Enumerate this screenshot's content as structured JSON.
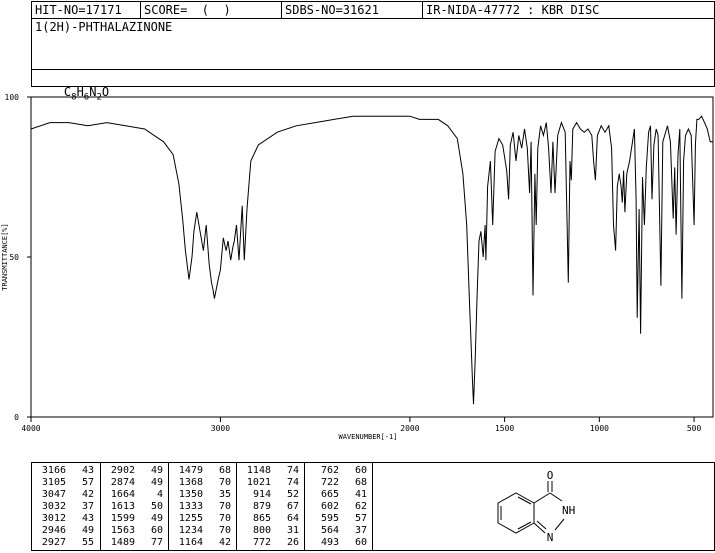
{
  "header": {
    "hit_no": "HIT-NO=17171",
    "score": "SCORE=  (  )",
    "sdbs_no": "SDBS-NO=31621",
    "ir_nida": "IR-NIDA-47772 : KBR DISC"
  },
  "compound": {
    "name": "1(2H)-PHTHALAZINONE",
    "formula_c": "C",
    "formula_c_n": "8",
    "formula_h": "H",
    "formula_h_n": "6",
    "formula_n": "N",
    "formula_n_n": "2",
    "formula_o": "O"
  },
  "chart_data": {
    "type": "line",
    "xlabel": "WAVENUMBER[-1]",
    "ylabel": "TRANSMITTANCE[%]",
    "xlim": [
      4000,
      400
    ],
    "ylim": [
      0,
      100
    ],
    "x_ticks": [
      4000,
      3000,
      2000,
      1500,
      1000,
      500
    ],
    "x_tick_labels": [
      "4000",
      "3000",
      "2000",
      "1500",
      "1000",
      "500"
    ],
    "y_ticks": [
      0,
      50,
      100
    ],
    "y_tick_labels": [
      "0",
      "50",
      "100"
    ],
    "series": [
      {
        "x": [
          4000,
          3900,
          3800,
          3700,
          3600,
          3500,
          3400,
          3350,
          3300,
          3250,
          3220,
          3200,
          3185,
          3166,
          3150,
          3140,
          3125,
          3105,
          3090,
          3075,
          3060,
          3047,
          3040,
          3032,
          3022,
          3012,
          3000,
          2985,
          2970,
          2960,
          2946,
          2935,
          2927,
          2915,
          2902,
          2895,
          2885,
          2874,
          2860,
          2840,
          2800,
          2700,
          2600,
          2500,
          2400,
          2300,
          2200,
          2100,
          2000,
          1950,
          1900,
          1850,
          1800,
          1750,
          1720,
          1700,
          1685,
          1670,
          1664,
          1655,
          1645,
          1635,
          1625,
          1613,
          1603,
          1599,
          1590,
          1575,
          1563,
          1550,
          1530,
          1510,
          1489,
          1479,
          1470,
          1455,
          1440,
          1425,
          1410,
          1395,
          1380,
          1368,
          1360,
          1350,
          1340,
          1333,
          1325,
          1310,
          1295,
          1280,
          1268,
          1255,
          1245,
          1234,
          1220,
          1200,
          1180,
          1164,
          1155,
          1148,
          1140,
          1120,
          1100,
          1080,
          1060,
          1040,
          1030,
          1021,
          1010,
          990,
          970,
          950,
          935,
          925,
          914,
          905,
          895,
          885,
          879,
          872,
          865,
          855,
          840,
          825,
          815,
          806,
          800,
          790,
          782,
          772,
          762,
          752,
          740,
          730,
          722,
          712,
          700,
          690,
          675,
          665,
          655,
          640,
          625,
          610,
          602,
          595,
          585,
          575,
          564,
          555,
          545,
          530,
          515,
          500,
          493,
          485,
          475,
          460,
          445,
          430,
          415,
          400
        ],
        "y": [
          90,
          92,
          92,
          91,
          92,
          91,
          90,
          88,
          86,
          82,
          73,
          62,
          52,
          43,
          50,
          58,
          64,
          57,
          52,
          60,
          48,
          42,
          40,
          37,
          40,
          43,
          46,
          56,
          52,
          55,
          49,
          53,
          55,
          60,
          49,
          56,
          66,
          49,
          65,
          80,
          85,
          89,
          91,
          92,
          93,
          94,
          94,
          94,
          94,
          93,
          93,
          93,
          91,
          87,
          76,
          60,
          35,
          12,
          4,
          18,
          38,
          55,
          58,
          50,
          60,
          49,
          72,
          80,
          60,
          83,
          87,
          85,
          77,
          68,
          85,
          89,
          80,
          88,
          84,
          90,
          84,
          70,
          86,
          38,
          76,
          60,
          84,
          91,
          88,
          92,
          84,
          70,
          86,
          70,
          88,
          92,
          89,
          42,
          80,
          74,
          90,
          92,
          90,
          89,
          90,
          88,
          80,
          74,
          88,
          91,
          89,
          91,
          84,
          60,
          52,
          72,
          76,
          72,
          67,
          77,
          64,
          76,
          80,
          86,
          90,
          68,
          31,
          65,
          26,
          75,
          60,
          78,
          89,
          91,
          68,
          85,
          90,
          88,
          41,
          86,
          88,
          91,
          86,
          62,
          78,
          57,
          82,
          90,
          37,
          80,
          88,
          90,
          88,
          60,
          85,
          93,
          93,
          94,
          92,
          90,
          86,
          86
        ]
      }
    ]
  },
  "peaks": [
    [
      [
        "3166",
        "43"
      ],
      [
        "3105",
        "57"
      ],
      [
        "3047",
        "42"
      ],
      [
        "3032",
        "37"
      ],
      [
        "3012",
        "43"
      ],
      [
        "2946",
        "49"
      ],
      [
        "2927",
        "55"
      ]
    ],
    [
      [
        "2902",
        "49"
      ],
      [
        "2874",
        "49"
      ],
      [
        "1664",
        "4"
      ],
      [
        "1613",
        "50"
      ],
      [
        "1599",
        "49"
      ],
      [
        "1563",
        "60"
      ],
      [
        "1489",
        "77"
      ]
    ],
    [
      [
        "1479",
        "68"
      ],
      [
        "1368",
        "70"
      ],
      [
        "1350",
        "35"
      ],
      [
        "1333",
        "70"
      ],
      [
        "1255",
        "70"
      ],
      [
        "1234",
        "70"
      ],
      [
        "1164",
        "42"
      ]
    ],
    [
      [
        "1148",
        "74"
      ],
      [
        "1021",
        "74"
      ],
      [
        "914",
        "52"
      ],
      [
        "879",
        "67"
      ],
      [
        "865",
        "64"
      ],
      [
        "800",
        "31"
      ],
      [
        "772",
        "26"
      ]
    ],
    [
      [
        "762",
        "60"
      ],
      [
        "722",
        "68"
      ],
      [
        "665",
        "41"
      ],
      [
        "602",
        "62"
      ],
      [
        "595",
        "57"
      ],
      [
        "564",
        "37"
      ],
      [
        "493",
        "60"
      ]
    ]
  ],
  "structure": {
    "atom_o": "O",
    "atom_nh": "NH",
    "atom_n": "N"
  }
}
